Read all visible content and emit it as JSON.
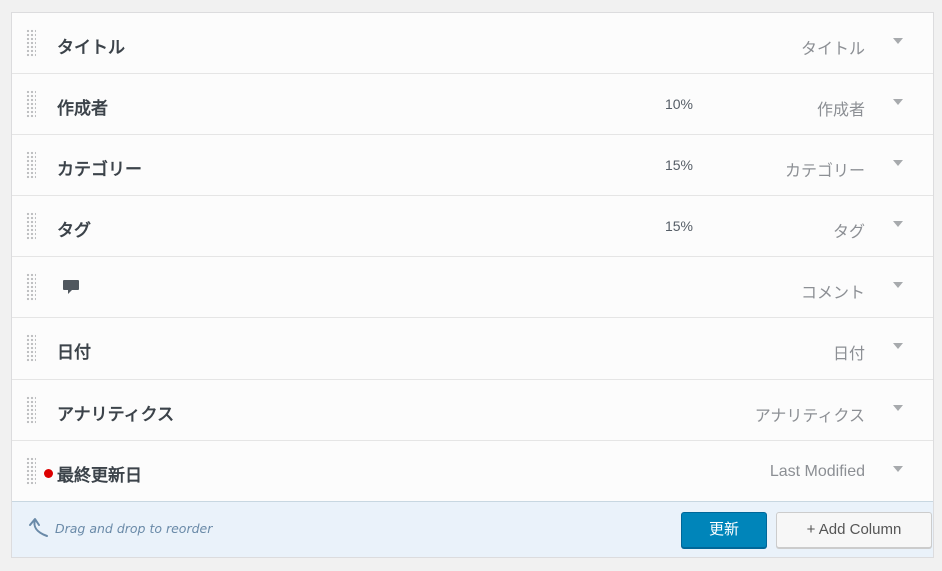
{
  "columns": [
    {
      "label": "タイトル",
      "width": "",
      "type": "タイトル"
    },
    {
      "label": "作成者",
      "width": "10%",
      "type": "作成者"
    },
    {
      "label": "カテゴリー",
      "width": "15%",
      "type": "カテゴリー"
    },
    {
      "label": "タグ",
      "width": "15%",
      "type": "タグ"
    },
    {
      "label": "",
      "icon": "comment-icon",
      "width": "",
      "type": "コメント"
    },
    {
      "label": "日付",
      "width": "",
      "type": "日付"
    },
    {
      "label": "アナリティクス",
      "width": "",
      "type": "アナリティクス"
    },
    {
      "label": "最終更新日",
      "width": "",
      "type": "Last Modified",
      "indicator_color": "#dd0000"
    }
  ],
  "footer": {
    "hint": "Drag and drop to reorder",
    "update_label": "更新",
    "add_column_label": "+ Add Column"
  },
  "colors": {
    "primary_button": "#0085ba",
    "footer_bg": "#eaf2fa"
  }
}
